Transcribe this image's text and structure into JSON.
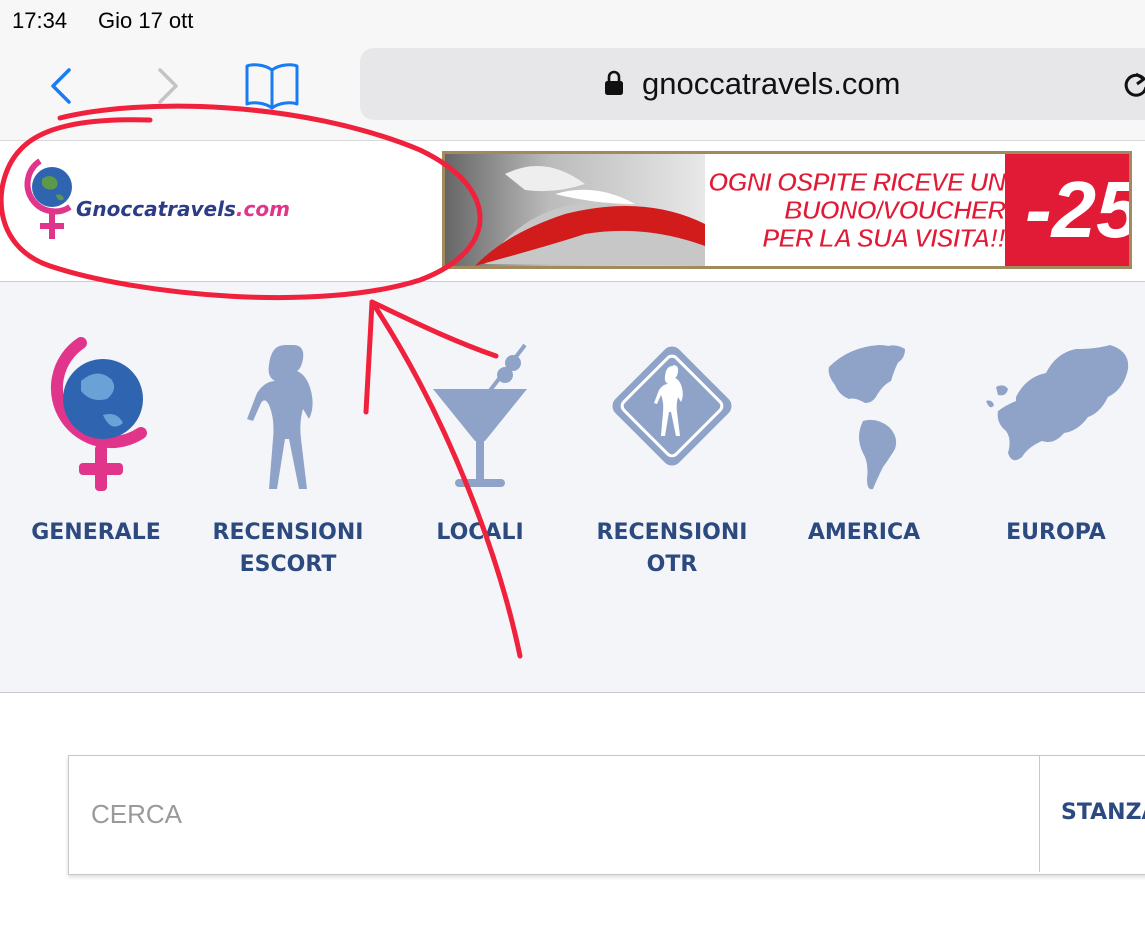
{
  "status_bar": {
    "time": "17:34",
    "date": "Gio 17 ott"
  },
  "browser": {
    "url": "gnoccatravels.com",
    "icons": {
      "back": "chevron-left-icon",
      "forward": "chevron-right-icon",
      "bookmarks": "book-icon",
      "lock": "lock-icon",
      "reload": "reload-icon"
    },
    "accent": "#1a7cf5"
  },
  "site": {
    "logo_text": "Gnoccatravels",
    "logo_domain": ".com",
    "banner": {
      "line1": "OGNI OSPITE RICEVE UN",
      "line2": "BUONO/VOUCHER",
      "line3": "PER LA SUA VISITA!!",
      "discount": "-25"
    },
    "categories": [
      {
        "line1": "GENERALE",
        "line2": "",
        "icon": "globe-female-icon"
      },
      {
        "line1": "RECENSIONI",
        "line2": "ESCORT",
        "icon": "woman-silhouette-icon"
      },
      {
        "line1": "LOCALI",
        "line2": "",
        "icon": "cocktail-icon"
      },
      {
        "line1": "RECENSIONI",
        "line2": "OTR",
        "icon": "road-sign-icon"
      },
      {
        "line1": "AMERICA",
        "line2": "",
        "icon": "america-map-icon"
      },
      {
        "line1": "EUROPA",
        "line2": "",
        "icon": "europe-map-icon"
      }
    ],
    "search": {
      "placeholder": "CERCA",
      "filter_label": "STANZA"
    },
    "colors": {
      "nav_text": "#2c4a80",
      "icon_gray": "#8fa3c8",
      "annotation_red": "#f0213c",
      "brand_pink": "#e0358b"
    }
  }
}
